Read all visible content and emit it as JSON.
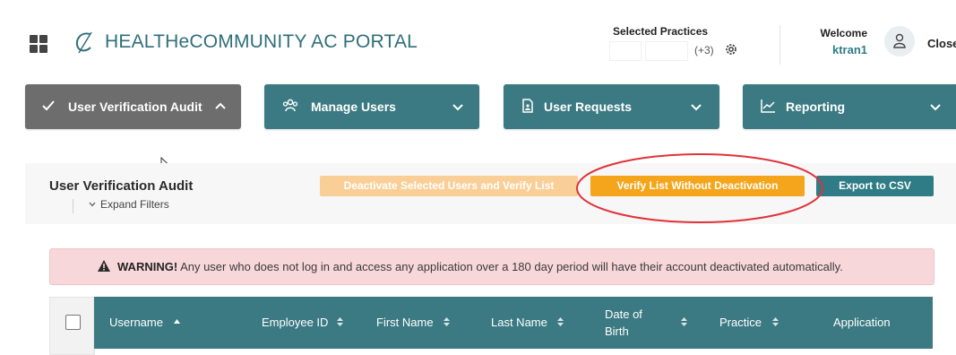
{
  "header": {
    "brand": "HEALTHeCOMMUNITY AC PORTAL",
    "selected_practices_label": "Selected Practices",
    "selected_practices_count": "(+3)",
    "welcome_label": "Welcome",
    "username": "ktran1",
    "close_label": "Close"
  },
  "nav": {
    "items": [
      {
        "label": "User Verification Audit",
        "icon": "check-icon",
        "chevron": "up"
      },
      {
        "label": "Manage Users",
        "icon": "users-icon",
        "chevron": "down"
      },
      {
        "label": "User Requests",
        "icon": "document-icon",
        "chevron": "down"
      },
      {
        "label": "Reporting",
        "icon": "chart-icon",
        "chevron": "down"
      }
    ]
  },
  "panel": {
    "title": "User Verification Audit",
    "expand_filters": "Expand Filters",
    "buttons": {
      "deactivate": "Deactivate Selected Users and Verify List",
      "verify": "Verify List Without Deactivation",
      "export": "Export to CSV"
    }
  },
  "warning": {
    "strong": "WARNING!",
    "text": " Any user who does not log in and access any application over a 180 day period will have their account deactivated automatically."
  },
  "table": {
    "columns": [
      "Username",
      "Employee ID",
      "First Name",
      "Last Name",
      "Date of",
      "Birth",
      "Practice",
      "Application"
    ]
  },
  "colors": {
    "brand": "#2f6f7a",
    "nav_active": "#6d6d6d",
    "nav": "#3b7a82",
    "deactivate": "#f9cf97",
    "verify": "#f4a51c",
    "export": "#2f7b86",
    "warning_bg": "#f8d7da",
    "highlight": "#e0323a"
  }
}
